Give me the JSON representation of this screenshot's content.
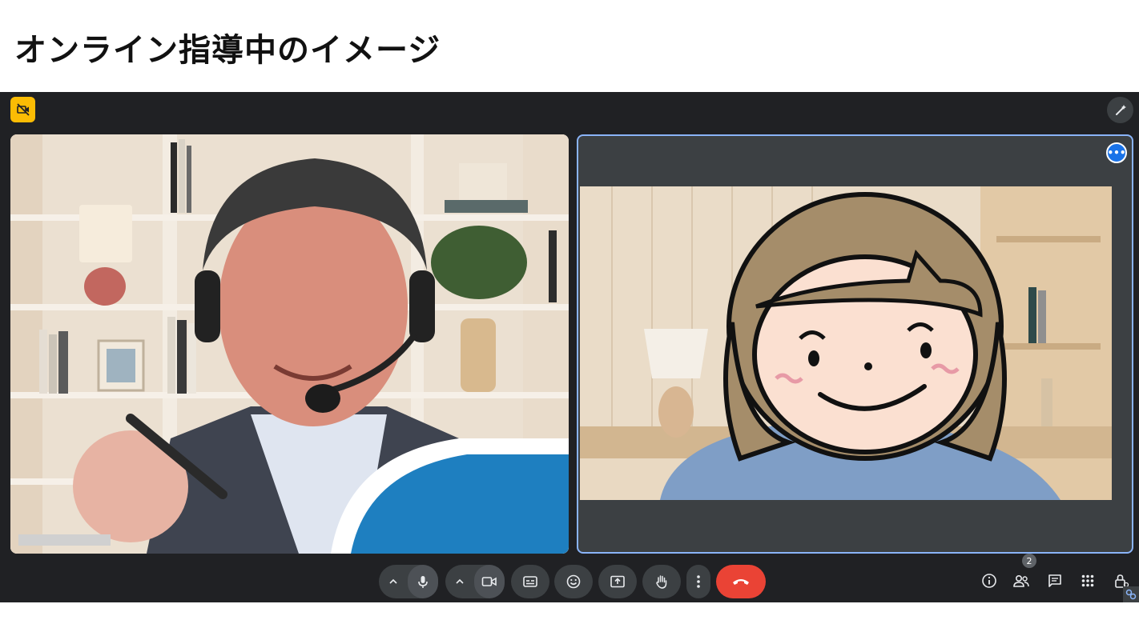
{
  "header": {
    "title": "オンライン指導中のイメージ"
  },
  "meeting": {
    "participants_count": "2",
    "tile_menu_glyph": "•••"
  },
  "icons": {
    "top_left": "no-camera-icon",
    "top_right": "magic-pen-icon",
    "tile_more": "more-horiz-icon",
    "toolbar": [
      "chevron-up-icon",
      "mic-icon",
      "chevron-up-icon",
      "camera-icon",
      "captions-icon",
      "emoji-icon",
      "present-icon",
      "raise-hand-icon",
      "more-vert-icon",
      "end-call-icon",
      "info-icon",
      "people-icon",
      "chat-icon",
      "activities-icon",
      "host-controls-icon"
    ]
  },
  "colors": {
    "window_bg": "#202124",
    "control_bg": "#3c4043",
    "end_call": "#ea4335",
    "highlight": "#8ab4f8",
    "accent_blue": "#1a73e8",
    "camera_off_badge": "#fbbc04"
  }
}
